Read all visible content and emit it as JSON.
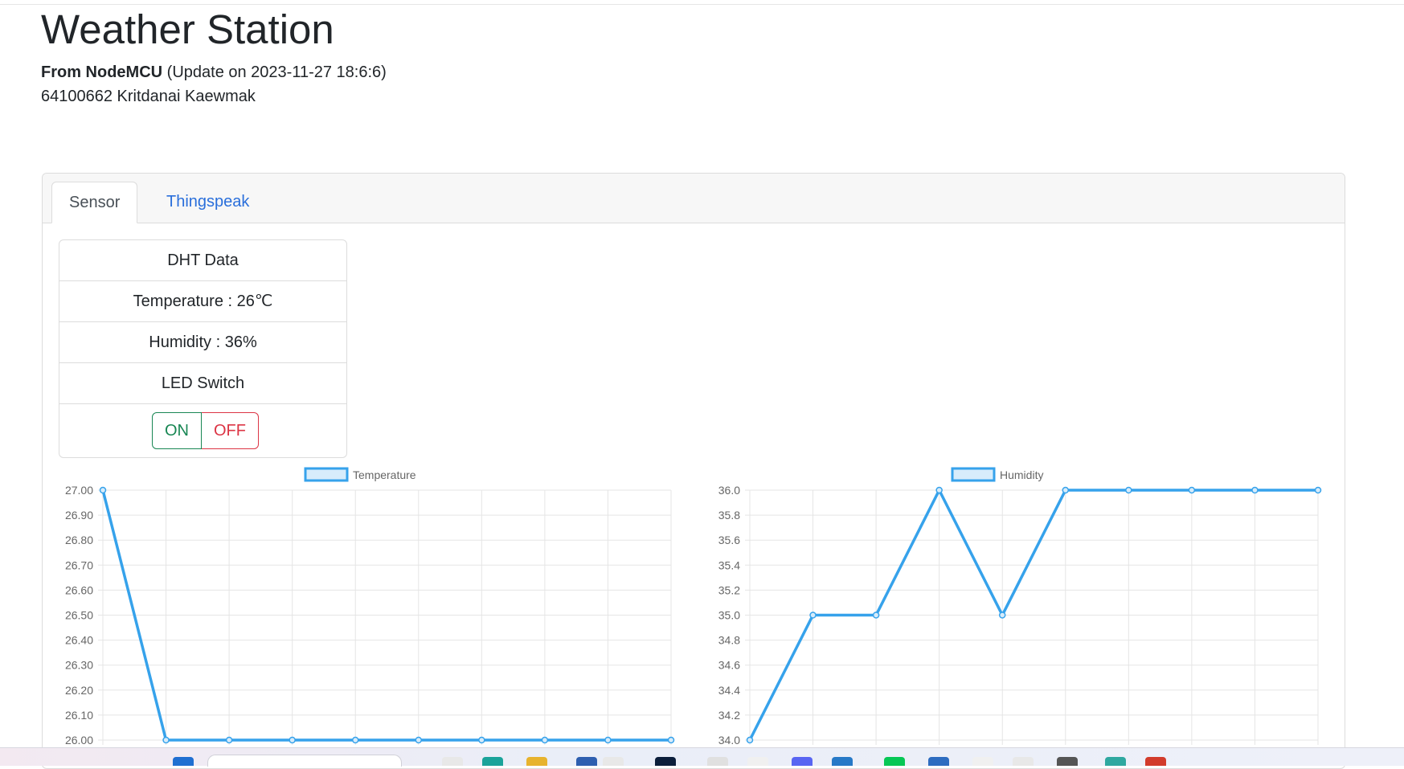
{
  "header": {
    "title": "Weather Station",
    "source_label": "From NodeMCU",
    "update_text": "(Update on 2023-11-27 18:6:6)",
    "student": "64100662 Kritdanai Kaewmak"
  },
  "tabs": [
    {
      "label": "Sensor",
      "active": true
    },
    {
      "label": "Thingspeak",
      "active": false
    }
  ],
  "dht": {
    "heading": "DHT Data",
    "temperature": "Temperature : 26℃",
    "humidity": "Humidity : 36%",
    "led_label": "LED Switch",
    "on_label": "ON",
    "off_label": "OFF"
  },
  "colors": {
    "line": "#36a2eb",
    "line_fill": "#d7ecfb",
    "grid": "#e5e5e5",
    "link": "#2a6fdb",
    "on": "#198754",
    "off": "#dc3545"
  },
  "taskbar_icons": [
    "windows-start-icon",
    "search-box",
    "app-icon",
    "edge-icon",
    "file-explorer-icon",
    "store-icon",
    "app-icon",
    "terminal-icon",
    "app-icon",
    "app-icon",
    "discord-icon",
    "vscode-icon",
    "line-icon",
    "app-icon",
    "app-icon",
    "app-icon",
    "app-icon",
    "app-icon",
    "chrome-icon"
  ],
  "chart_data": [
    {
      "type": "line",
      "legend": "Temperature",
      "yticks": [
        "27.00",
        "26.90",
        "26.80",
        "26.70",
        "26.60",
        "26.50",
        "26.40",
        "26.30",
        "26.20",
        "26.10",
        "26.00"
      ],
      "ylim": [
        26,
        27
      ],
      "values": [
        27,
        26,
        26,
        26,
        26,
        26,
        26,
        26,
        26,
        26
      ],
      "grid": true,
      "legend_position": "top-center"
    },
    {
      "type": "line",
      "legend": "Humidity",
      "yticks": [
        "36.0",
        "35.8",
        "35.6",
        "35.4",
        "35.2",
        "35.0",
        "34.8",
        "34.6",
        "34.4",
        "34.2",
        "34.0"
      ],
      "ylim": [
        34,
        36
      ],
      "values": [
        34,
        35,
        35,
        36,
        35,
        36,
        36,
        36,
        36,
        36
      ],
      "grid": true,
      "legend_position": "top-center"
    }
  ]
}
